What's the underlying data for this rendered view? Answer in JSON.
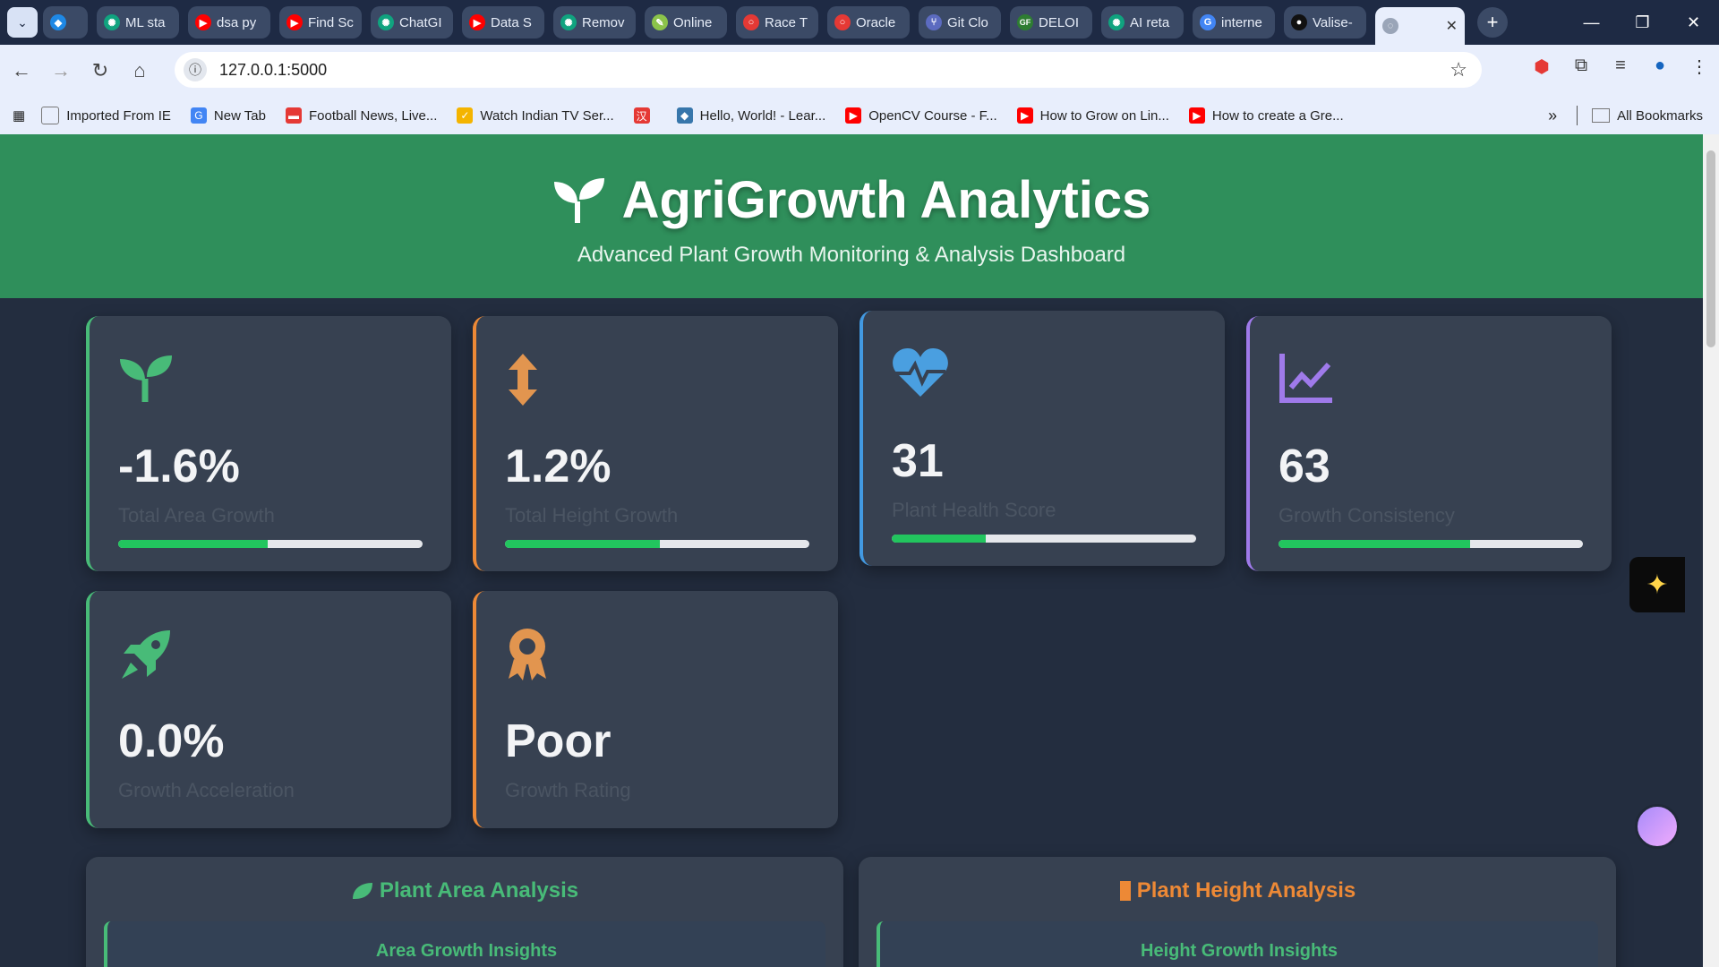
{
  "browser": {
    "tabs": [
      {
        "label": "",
        "fav_color": "#1e88e5",
        "fav_icon": "gem-icon"
      },
      {
        "label": "ML sta",
        "fav_color": "#10a37f",
        "fav_icon": "openai-icon"
      },
      {
        "label": "dsa py",
        "fav_color": "#ff0000",
        "fav_icon": "youtube-icon"
      },
      {
        "label": "Find Sc",
        "fav_color": "#ff0000",
        "fav_icon": "youtube-icon"
      },
      {
        "label": "ChatGI",
        "fav_color": "#10a37f",
        "fav_icon": "openai-icon"
      },
      {
        "label": "Data S",
        "fav_color": "#ff0000",
        "fav_icon": "youtube-icon"
      },
      {
        "label": "Remov",
        "fav_color": "#10a37f",
        "fav_icon": "openai-icon"
      },
      {
        "label": "Online",
        "fav_color": "#8bc34a",
        "fav_icon": "online-icon"
      },
      {
        "label": "Race T",
        "fav_color": "#e53935",
        "fav_icon": "oracle-icon"
      },
      {
        "label": "Oracle",
        "fav_color": "#e53935",
        "fav_icon": "oracle-icon"
      },
      {
        "label": "Git Clo",
        "fav_color": "#5c6bc0",
        "fav_icon": "git-icon"
      },
      {
        "label": "DELOI",
        "fav_color": "#2e7d32",
        "fav_icon": "gf-icon"
      },
      {
        "label": "AI reta",
        "fav_color": "#10a37f",
        "fav_icon": "openai-icon"
      },
      {
        "label": "interne",
        "fav_color": "#4285f4",
        "fav_icon": "google-icon"
      },
      {
        "label": "Valise-",
        "fav_color": "#111111",
        "fav_icon": "github-icon"
      }
    ],
    "url": "127.0.0.1:5000",
    "bookmarks": [
      {
        "label": "Imported From IE",
        "color": "#888888"
      },
      {
        "label": "New Tab",
        "color": "#4285f4"
      },
      {
        "label": "Football News, Live...",
        "color": "#e53935"
      },
      {
        "label": "Watch Indian TV Ser...",
        "color": "#f4b400"
      },
      {
        "label": "",
        "color": "#e53935"
      },
      {
        "label": "Hello, World! - Lear...",
        "color": "#3776ab"
      },
      {
        "label": "OpenCV Course - F...",
        "color": "#ff0000"
      },
      {
        "label": "How to Grow on Lin...",
        "color": "#ff0000"
      },
      {
        "label": "How to create a Gre...",
        "color": "#ff0000"
      }
    ],
    "all_bookmarks": "All Bookmarks"
  },
  "header": {
    "title": "AgriGrowth Analytics",
    "subtitle": "Advanced Plant Growth Monitoring & Analysis Dashboard"
  },
  "cards": [
    {
      "value": "-1.6%",
      "label": "Total Area Growth",
      "progress": 0.49,
      "accent": "#48bb78",
      "icon": "seedling-icon"
    },
    {
      "value": "1.2%",
      "label": "Total Height Growth",
      "progress": 0.51,
      "accent": "#ed8936",
      "icon": "arrows-vertical-icon"
    },
    {
      "value": "31",
      "label": "Plant Health Score",
      "progress": 0.31,
      "accent": "#4299e1",
      "icon": "heartbeat-icon"
    },
    {
      "value": "63",
      "label": "Growth Consistency",
      "progress": 0.63,
      "accent": "#9f7aea",
      "icon": "chart-line-icon"
    },
    {
      "value": "0.0%",
      "label": "Growth Acceleration",
      "accent": "#48bb78",
      "icon": "rocket-icon"
    },
    {
      "value": "Poor",
      "label": "Growth Rating",
      "accent": "#ed8936",
      "icon": "award-icon"
    }
  ],
  "panels": {
    "area": {
      "title": "Plant Area Analysis",
      "sub": "Area Growth Insights",
      "color": "#48bb78"
    },
    "height": {
      "title": "Plant Height Analysis",
      "sub": "Height Growth Insights",
      "color": "#ed8936"
    }
  }
}
